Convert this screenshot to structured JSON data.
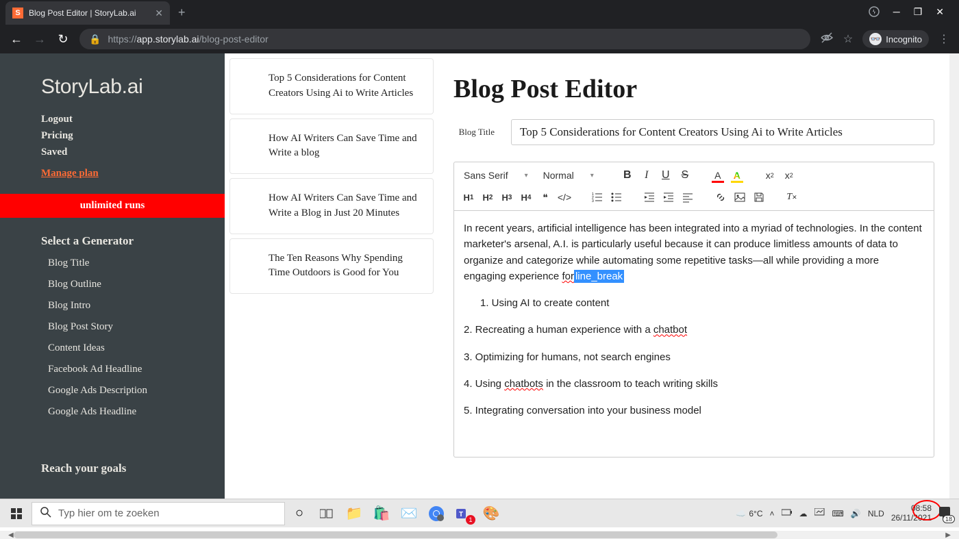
{
  "browser": {
    "tab_title": "Blog Post Editor | StoryLab.ai",
    "url_scheme": "https://",
    "url_domain": "app.storylab.ai",
    "url_path": "/blog-post-editor",
    "incognito_label": "Incognito"
  },
  "sidebar": {
    "logo": "StoryLab.ai",
    "links": {
      "logout": "Logout",
      "pricing": "Pricing",
      "saved": "Saved",
      "manage_plan": "Manage plan"
    },
    "unlimited": "unlimited runs",
    "select_generator": "Select a Generator",
    "generators": [
      "Blog Title",
      "Blog Outline",
      "Blog Intro",
      "Blog Post Story",
      "Content Ideas",
      "Facebook Ad Headline",
      "Google Ads Description",
      "Google Ads Headline"
    ],
    "goals": "Reach your goals"
  },
  "posts": [
    "Top 5 Considerations for Content Creators Using Ai to Write Articles",
    "How AI Writers Can Save Time and Write a blog",
    "How AI Writers Can Save Time and Write a Blog in Just 20 Minutes",
    "The Ten Reasons Why Spending Time Outdoors is Good for You"
  ],
  "editor": {
    "page_title": "Blog Post Editor",
    "title_label": "Blog Title",
    "title_value": "Top 5 Considerations for Content Creators Using Ai to Write Articles",
    "font_family": "Sans Serif",
    "font_size": "Normal",
    "body_para_1": "In recent years, artificial intelligence has been integrated into a myriad of technologies. In the content marketer's arsenal, A.I. is particularly useful because it can produce limitless amounts of data to organize and categorize while automating some repetitive tasks—all while providing a more engaging experience ",
    "for_text": "for",
    "line_break": "line_break",
    "list_1": "1. Using AI to create content",
    "list_2a": "2. Recreating a human experience with a ",
    "list_2b": "chatbot",
    "list_3": "3. Optimizing for humans, not search engines",
    "list_4a": "4. Using ",
    "list_4b": "chatbots",
    "list_4c": " in the classroom to teach writing skills",
    "list_5": "5. Integrating conversation into your business model"
  },
  "taskbar": {
    "search_placeholder": "Typ hier om te zoeken",
    "temp": "6°C",
    "lang": "NLD",
    "time": "08:58",
    "date": "26/11/2021",
    "notif_count": "18"
  }
}
